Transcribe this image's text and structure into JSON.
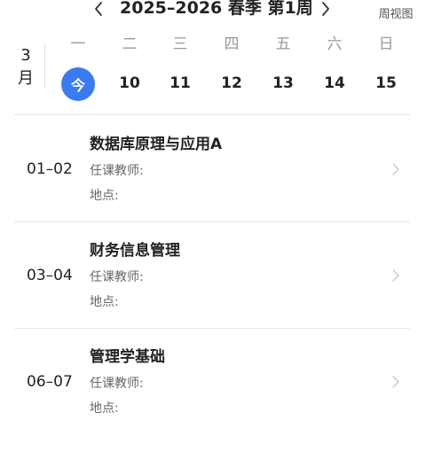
{
  "header": {
    "title": "2025–2026 春季 第1周",
    "prev_icon": "chevron-left-icon",
    "next_icon": "chevron-right-icon",
    "week_view_label": "周视图"
  },
  "calendar": {
    "month": "3",
    "month_suffix": "月",
    "days": [
      {
        "weekday": "一",
        "date": "今",
        "today": true
      },
      {
        "weekday": "二",
        "date": "10"
      },
      {
        "weekday": "三",
        "date": "11"
      },
      {
        "weekday": "四",
        "date": "12"
      },
      {
        "weekday": "五",
        "date": "13"
      },
      {
        "weekday": "六",
        "date": "14"
      },
      {
        "weekday": "日",
        "date": "15"
      }
    ],
    "today_color": "#3a7bf0"
  },
  "courses": [
    {
      "period": "01–02",
      "name": "数据库原理与应用A",
      "teacher_label": "任课教师:",
      "location_label": "地点:"
    },
    {
      "period": "03–04",
      "name": "财务信息管理",
      "teacher_label": "任课教师:",
      "location_label": "地点:"
    },
    {
      "period": "06–07",
      "name": "管理学基础",
      "teacher_label": "任课教师:",
      "location_label": "地点:"
    }
  ]
}
